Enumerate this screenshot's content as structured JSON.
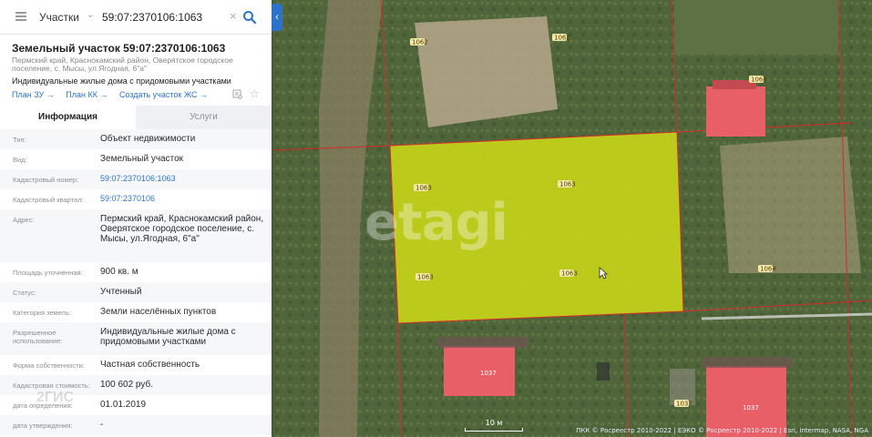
{
  "search": {
    "layer": "Участки",
    "query": "59:07:2370106:1063",
    "clear_glyph": "×",
    "collapse_glyph": "‹"
  },
  "parcel": {
    "title": "Земельный участок 59:07:2370106:1063",
    "address": "Пермский край, Краснокамский район, Оверятское городское поселение, с. Мысы, ул.Ягодная, 6\"а\"",
    "usage": "Индивидуальные жилые дома с придомовыми участками",
    "links": [
      "План ЗУ →",
      "План КК →",
      "Создать участок ЖС →"
    ]
  },
  "tabs": {
    "info": "Информация",
    "services": "Услуги"
  },
  "properties": [
    {
      "key": "Тип:",
      "value": "Объект недвижимости"
    },
    {
      "key": "Вид:",
      "value": "Земельный участок"
    },
    {
      "key": "Кадастровый номер:",
      "value": "59:07:2370106:1063",
      "link": true
    },
    {
      "key": "Кадастровый квартал:",
      "value": "59:07:2370106",
      "link": true
    },
    {
      "key": "Адрес:",
      "value": "Пермский край, Краснокамский район, Оверятское городское поселение, с. Мысы, ул.Ягодная, 6\"а\""
    },
    {
      "key": "Площадь уточненная:",
      "value": "900 кв. м"
    },
    {
      "key": "Статус:",
      "value": "Учтенный"
    },
    {
      "key": "Категория земель:",
      "value": "Земли населённых пунктов"
    },
    {
      "key": "Разрешенное использование:",
      "value": "Индивидуальные жилые дома с придомовыми участками"
    },
    {
      "key": "Форма собственности:",
      "value": "Частная собственность"
    },
    {
      "key": "Кадастровая стоимость:",
      "value": "100 602 руб."
    },
    {
      "key": "дата определения:",
      "value": "01.01.2019"
    },
    {
      "key": "дата утверждения:",
      "value": "-"
    }
  ],
  "map": {
    "lot_labels": [
      "1063",
      "1062",
      "1064",
      "1037"
    ],
    "watermark": "etagi",
    "watermark_2gis": "2ГИС",
    "scale_label": "10 м",
    "attribution": "ПКК © Росреестр 2010-2022 | ЕЭКО © Росреестр 2010-2022 | Esri, Intermap, NASA, NGA",
    "selected_color": "#c8d51a",
    "boundary_color": "#d82a2a",
    "building_color": "#e85f67"
  }
}
